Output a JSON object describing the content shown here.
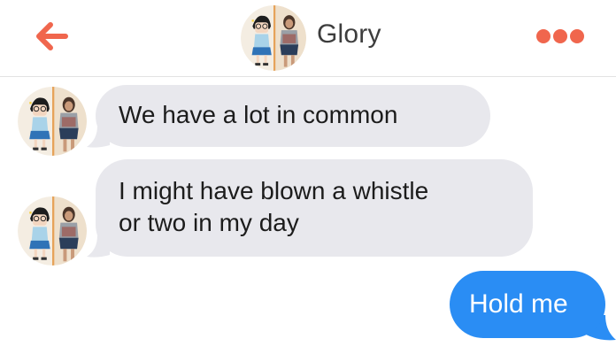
{
  "header": {
    "back_icon": "arrow-left-icon",
    "contact_name": "Glory",
    "more_icon": "more-dots-icon",
    "accent_color": "#f0664d"
  },
  "messages": [
    {
      "direction": "incoming",
      "text": "We have a lot in common"
    },
    {
      "direction": "incoming",
      "lines": [
        "I might have blown a whistle",
        "or two in my day"
      ]
    },
    {
      "direction": "outgoing",
      "text": "Hold me"
    }
  ],
  "colors": {
    "incoming_bubble": "#e8e8ed",
    "outgoing_bubble": "#2a8df4",
    "outgoing_text": "#ffffff"
  }
}
